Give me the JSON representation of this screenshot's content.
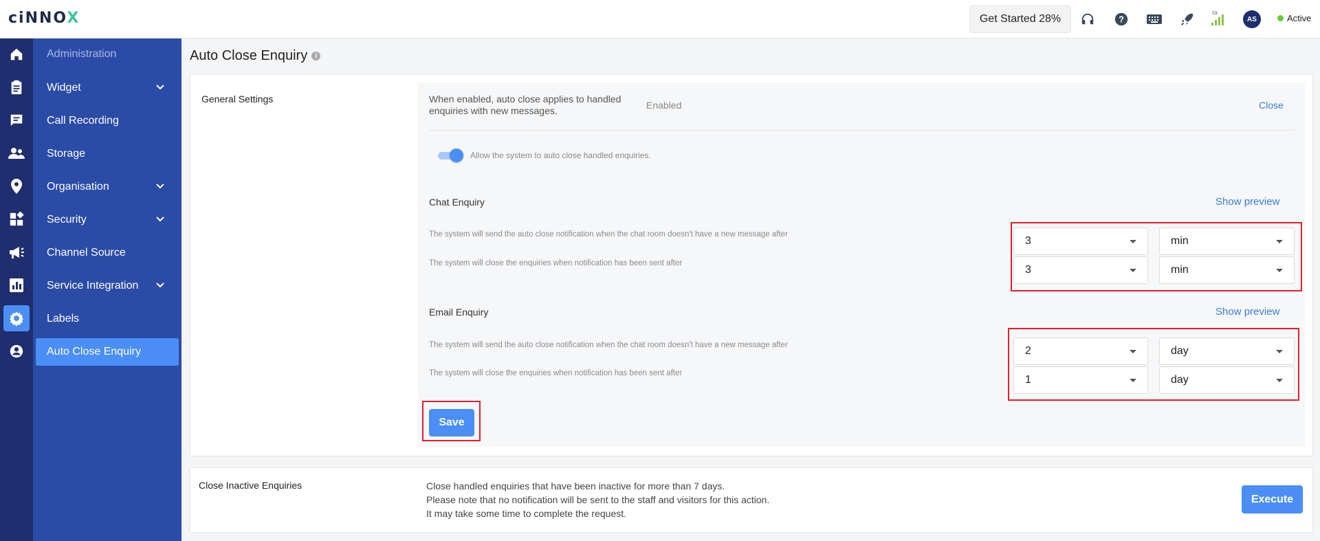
{
  "topbar": {
    "logo": "cinnox",
    "get_started": "Get Started 28%",
    "signal_label": "cx",
    "avatar": "AS",
    "status": "Active",
    "status_color": "#6cc93a"
  },
  "rail": {
    "icons": [
      "home-icon",
      "clipboard-icon",
      "chat-icon",
      "people-icon",
      "location-icon",
      "widgets-icon",
      "megaphone-icon",
      "chart-icon",
      "gear-icon",
      "account-icon"
    ],
    "active": "gear-icon"
  },
  "nav": {
    "title": "Administration",
    "items": [
      {
        "label": "Widget"
      },
      {
        "label": "Call Recording"
      },
      {
        "label": "Storage"
      },
      {
        "label": "Organisation"
      },
      {
        "label": "Security"
      },
      {
        "label": "Channel Source"
      },
      {
        "label": "Service Integration"
      },
      {
        "label": "Labels"
      },
      {
        "label": "Auto Close Enquiry"
      }
    ]
  },
  "page": {
    "title": "Auto Close Enquiry"
  },
  "general": {
    "label": "General Settings",
    "description": "When enabled, auto close applies to handled enquiries with new messages.",
    "state": "Enabled",
    "close_link": "Close",
    "toggle_label": "Allow the system to auto close handled enquiries.",
    "toggle_on": true
  },
  "chat": {
    "title": "Chat Enquiry",
    "preview": "Show preview",
    "rows": [
      {
        "hint": "The system will send the auto close notification when the chat room doesn't have a new message after",
        "value": "3",
        "unit": "min"
      },
      {
        "hint": "The system will close the enquiries when notification has been sent after",
        "value": "3",
        "unit": "min"
      }
    ]
  },
  "email": {
    "title": "Email Enquiry",
    "preview": "Show preview",
    "rows": [
      {
        "hint": "The system will send the auto close notification when the chat room doesn't have a new message after",
        "value": "2",
        "unit": "day"
      },
      {
        "hint": "The system will close the enquiries when notification has been sent after",
        "value": "1",
        "unit": "day"
      }
    ]
  },
  "save_label": "Save",
  "inactive": {
    "label": "Close Inactive Enquiries",
    "lines": [
      "Close handled enquiries that have been inactive for more than 7 days.",
      "Please note that no notification will be sent to the staff and visitors for this action.",
      "It may take some time to complete the request."
    ],
    "button": "Execute"
  },
  "colors": {
    "rail": "#1f2e6e",
    "sidebar": "#2b4ca6",
    "accent": "#4a8ef6",
    "highlight": "#e0202a"
  }
}
